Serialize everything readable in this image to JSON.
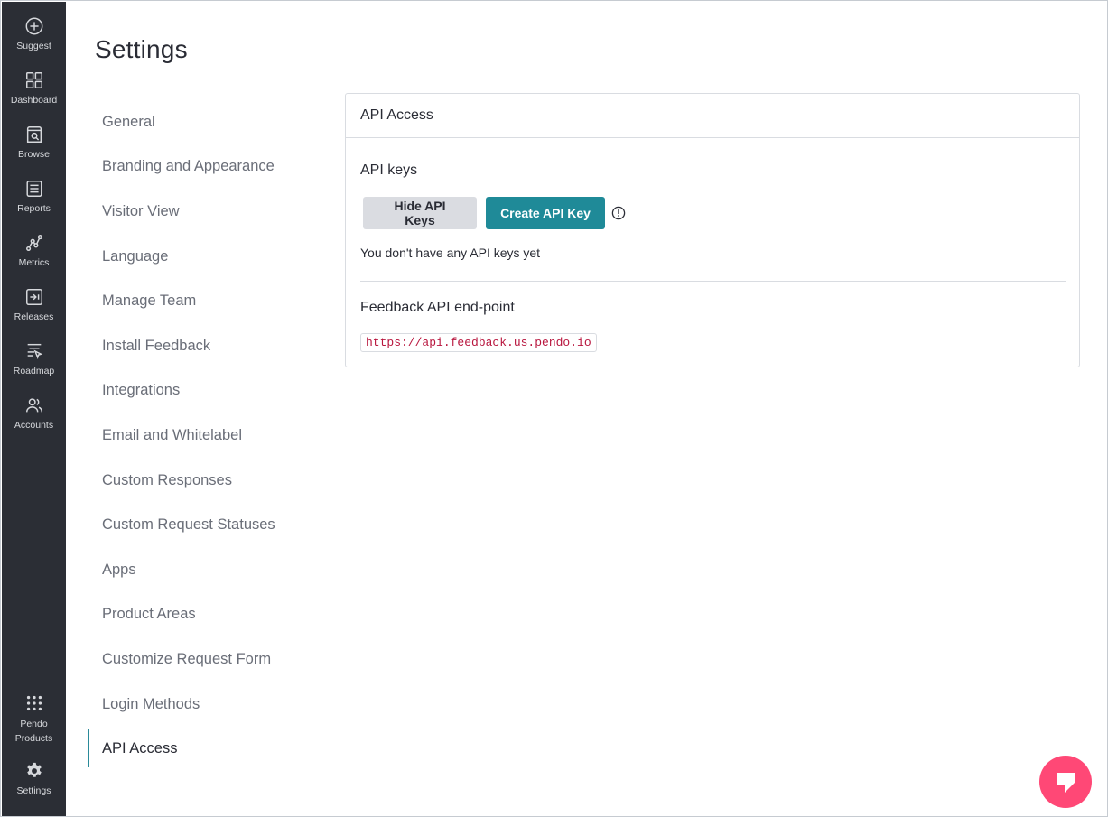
{
  "page": {
    "title": "Settings"
  },
  "rail": {
    "items": [
      {
        "label": "Suggest",
        "icon": "plus-circle-icon"
      },
      {
        "label": "Dashboard",
        "icon": "grid-icon"
      },
      {
        "label": "Browse",
        "icon": "browse-icon"
      },
      {
        "label": "Reports",
        "icon": "reports-icon"
      },
      {
        "label": "Metrics",
        "icon": "metrics-icon"
      },
      {
        "label": "Releases",
        "icon": "releases-icon"
      },
      {
        "label": "Roadmap",
        "icon": "roadmap-icon"
      },
      {
        "label": "Accounts",
        "icon": "accounts-icon"
      }
    ],
    "products": {
      "label_line1": "Pendo",
      "label_line2": "Products",
      "icon": "dots-grid-icon"
    },
    "settings": {
      "label": "Settings",
      "icon": "gear-icon"
    }
  },
  "nav": {
    "items": [
      "General",
      "Branding and Appearance",
      "Visitor View",
      "Language",
      "Manage Team",
      "Install Feedback",
      "Integrations",
      "Email and Whitelabel",
      "Custom Responses",
      "Custom Request Statuses",
      "Apps",
      "Product Areas",
      "Customize Request Form",
      "Login Methods",
      "API Access"
    ],
    "active": "API Access"
  },
  "card": {
    "header": "API Access",
    "api_keys_title": "API keys",
    "hide_button": "Hide API Keys",
    "create_button": "Create API Key",
    "empty_text": "You don't have any API keys yet",
    "endpoint_title": "Feedback API end-point",
    "endpoint_url": "https://api.feedback.us.pendo.io"
  },
  "colors": {
    "rail_bg": "#2b2e35",
    "accent": "#1f8a98",
    "fab": "#ff4876",
    "code_text": "#b8163e"
  },
  "fab": {
    "icon": "pendo-launcher-icon"
  }
}
